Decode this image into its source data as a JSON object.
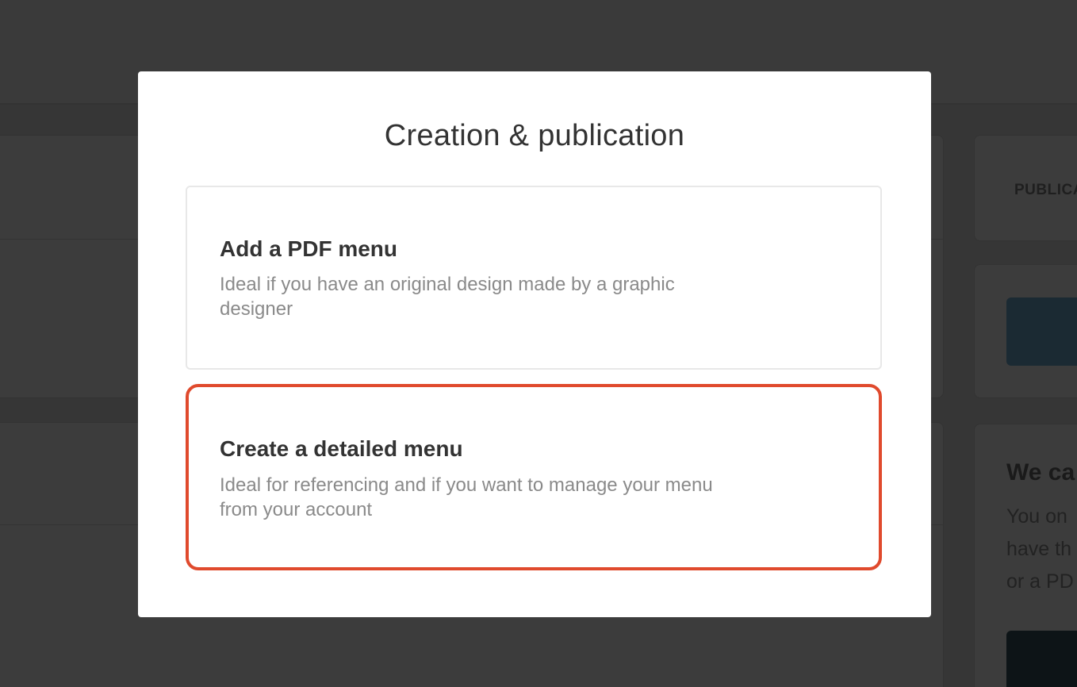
{
  "background": {
    "publication_label": "PUBLICA",
    "heading": "We ca",
    "body_lines": [
      "You on",
      "have th",
      "or a PD"
    ]
  },
  "modal": {
    "title": "Creation & publication",
    "options": [
      {
        "title": "Add a PDF menu",
        "description": "Ideal if you have an original design made by a graphic designer",
        "selected": false
      },
      {
        "title": "Create a detailed menu",
        "description": "Ideal for referencing and if you want to manage your menu from your account",
        "selected": true
      }
    ]
  },
  "colors": {
    "overlay": "#363636",
    "selected_border": "#e04a2d",
    "title_text": "#333333",
    "description_text": "#8a8a8a"
  }
}
